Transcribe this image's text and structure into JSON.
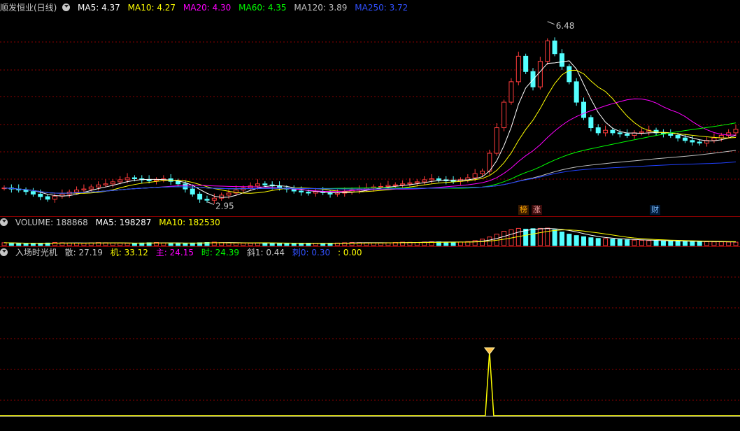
{
  "header": {
    "title": "顺发恒业(日线)",
    "ma5": "MA5: 4.37",
    "ma10": "MA10: 4.27",
    "ma20": "MA20: 4.30",
    "ma60": "MA60: 4.35",
    "ma120": "MA120: 3.89",
    "ma250": "MA250: 3.72"
  },
  "annotations": {
    "high": "6.48",
    "low": "2.95"
  },
  "event_tags": {
    "bang": "榜",
    "zhang": "涨",
    "cai": "财"
  },
  "volume_header": {
    "label": "VOLUME: 188868",
    "ma5": "MA5: 198287",
    "ma10": "MA10: 182530"
  },
  "indicator_header": {
    "name": "入场时光机",
    "san": "散: 27.19",
    "ji": "机: 33.12",
    "zhu": "主: 24.15",
    "shi": "时: 24.39",
    "xie": "斜1: 0.44",
    "ci": "刺0: 0.30",
    "extra": ": 0.00"
  },
  "colors": {
    "up": "#ff3c3c",
    "down": "#54ffff",
    "ma5": "#ffffff",
    "ma10": "#ffff00",
    "ma20": "#ff00ff",
    "ma60": "#00ff00",
    "ma120": "#c0c0c0",
    "ma250": "#2040ff",
    "grid": "#8b0000",
    "signal": "#ffff00"
  },
  "chart_data": {
    "type": "candlestick",
    "high_mark": 6.48,
    "low_mark": 2.95,
    "closes": [
      3.22,
      3.2,
      3.18,
      3.15,
      3.1,
      3.05,
      3.0,
      3.06,
      3.1,
      3.14,
      3.18,
      3.2,
      3.24,
      3.28,
      3.3,
      3.34,
      3.38,
      3.42,
      3.4,
      3.38,
      3.36,
      3.38,
      3.4,
      3.35,
      3.3,
      3.2,
      3.1,
      3.0,
      2.98,
      3.02,
      3.08,
      3.12,
      3.18,
      3.22,
      3.26,
      3.3,
      3.28,
      3.26,
      3.22,
      3.2,
      3.16,
      3.14,
      3.12,
      3.15,
      3.13,
      3.1,
      3.12,
      3.14,
      3.18,
      3.2,
      3.22,
      3.24,
      3.25,
      3.27,
      3.28,
      3.3,
      3.32,
      3.34,
      3.38,
      3.4,
      3.38,
      3.36,
      3.35,
      3.38,
      3.42,
      3.5,
      3.55,
      3.9,
      4.4,
      4.9,
      5.3,
      5.8,
      5.5,
      5.2,
      5.7,
      6.1,
      5.85,
      5.6,
      5.3,
      4.9,
      4.6,
      4.4,
      4.3,
      4.35,
      4.3,
      4.28,
      4.25,
      4.3,
      4.32,
      4.35,
      4.3,
      4.28,
      4.25,
      4.2,
      4.15,
      4.12,
      4.1,
      4.15,
      4.2,
      4.25,
      4.3,
      4.37
    ],
    "volumes": [
      20,
      18,
      15,
      16,
      14,
      15,
      18,
      22,
      20,
      18,
      17,
      16,
      19,
      21,
      20,
      18,
      17,
      16,
      15,
      18,
      20,
      22,
      19,
      17,
      16,
      15,
      18,
      20,
      22,
      24,
      21,
      19,
      18,
      17,
      16,
      18,
      19,
      17,
      16,
      15,
      14,
      16,
      17,
      15,
      14,
      16,
      18,
      20,
      22,
      21,
      20,
      19,
      18,
      20,
      22,
      24,
      23,
      22,
      25,
      27,
      26,
      24,
      23,
      25,
      28,
      35,
      45,
      60,
      80,
      100,
      110,
      120,
      115,
      118,
      120,
      122,
      110,
      95,
      80,
      70,
      62,
      55,
      50,
      48,
      45,
      42,
      40,
      38,
      37,
      35,
      33,
      32,
      31,
      30,
      29,
      28,
      28,
      27,
      26,
      26,
      25,
      24
    ],
    "signal_index": 67,
    "signal_value": 100
  }
}
